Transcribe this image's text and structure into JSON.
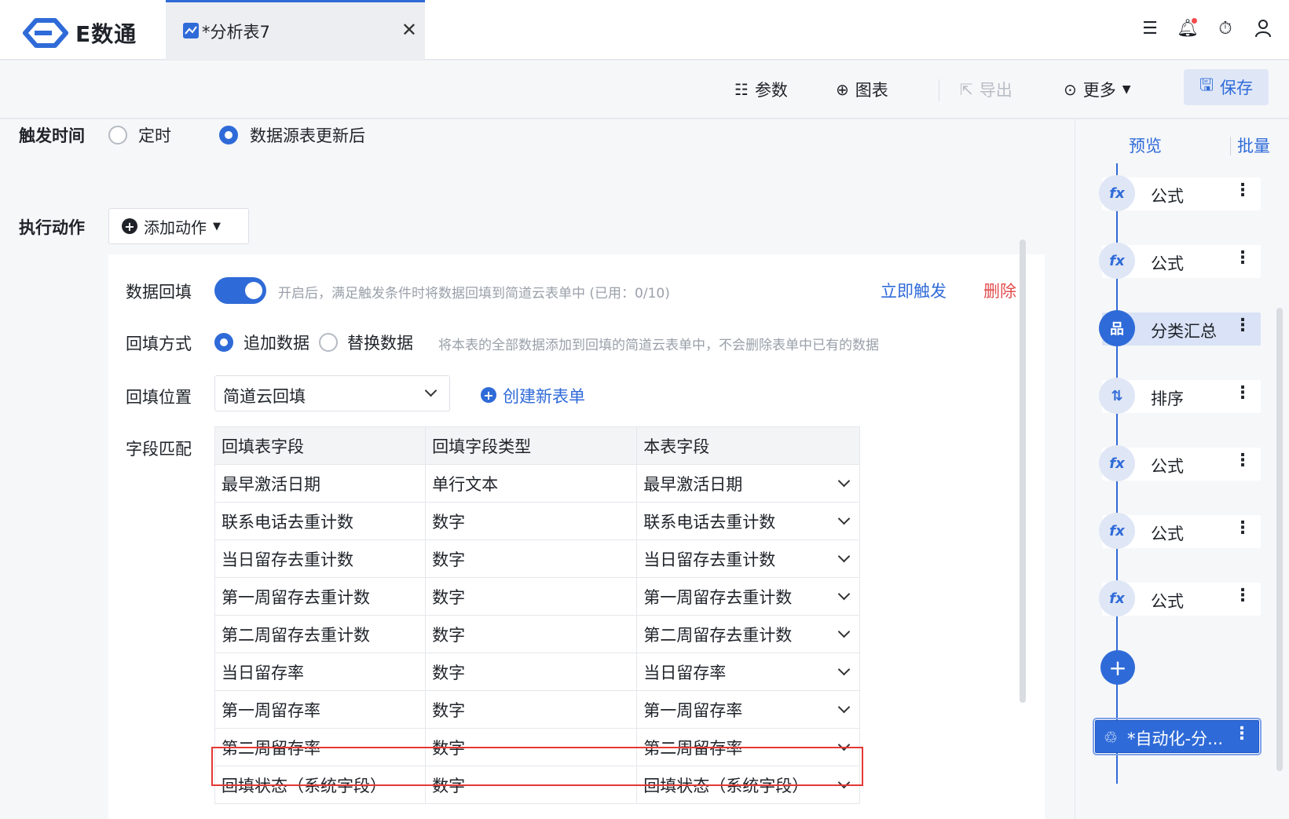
{
  "app": {
    "logo_text": "E数通"
  },
  "tab": {
    "label": "*分析表7",
    "close": "✕"
  },
  "toolbar": {
    "params": "参数",
    "chart": "图表",
    "export": "导出",
    "more": "更多",
    "save": "保存"
  },
  "trigger": {
    "label": "触发时间",
    "option_timed": "定时",
    "option_after_update": "数据源表更新后",
    "selected": "数据源表更新后"
  },
  "action": {
    "label": "执行动作",
    "add_button": "添加动作"
  },
  "backfill": {
    "label": "数据回填",
    "enabled": true,
    "hint": "开启后，满足触发条件时将数据回填到简道云表单中 (已用：0/10)",
    "trigger_now": "立即触发",
    "delete": "删除",
    "mode_label": "回填方式",
    "mode_append": "追加数据",
    "mode_replace": "替换数据",
    "mode_selected": "追加数据",
    "mode_hint": "将本表的全部数据添加到回填的简道云表单中，不会删除表单中已有的数据",
    "position_label": "回填位置",
    "position_value": "简道云回填",
    "create_form": "创建新表单",
    "mapping_label": "字段匹配"
  },
  "mapping": {
    "headers": [
      "回填表字段",
      "回填字段类型",
      "本表字段"
    ],
    "rows": [
      [
        "最早激活日期",
        "单行文本",
        "最早激活日期"
      ],
      [
        "联系电话去重计数",
        "数字",
        "联系电话去重计数"
      ],
      [
        "当日留存去重计数",
        "数字",
        "当日留存去重计数"
      ],
      [
        "第一周留存去重计数",
        "数字",
        "第一周留存去重计数"
      ],
      [
        "第二周留存去重计数",
        "数字",
        "第二周留存去重计数"
      ],
      [
        "当日留存率",
        "数字",
        "当日留存率"
      ],
      [
        "第一周留存率",
        "数字",
        "第一周留存率"
      ],
      [
        "第二周留存率",
        "数字",
        "第二周留存率"
      ],
      [
        "回填状态（系统字段）",
        "数字",
        "回填状态（系统字段）"
      ]
    ]
  },
  "right_panel": {
    "preview": "预览",
    "batch": "批量",
    "nodes": [
      {
        "label": "公式",
        "icon": "fx-icon",
        "glyph": "fx"
      },
      {
        "label": "公式",
        "icon": "fx-icon",
        "glyph": "fx"
      },
      {
        "label": "分类汇总",
        "icon": "hierarchy-icon",
        "glyph": "品",
        "active": true
      },
      {
        "label": "排序",
        "icon": "sort-icon",
        "glyph": "⇅"
      },
      {
        "label": "公式",
        "icon": "fx-icon",
        "glyph": "fx"
      },
      {
        "label": "公式",
        "icon": "fx-icon",
        "glyph": "fx"
      },
      {
        "label": "公式",
        "icon": "fx-icon",
        "glyph": "fx"
      }
    ],
    "add": "+",
    "automation": "*自动化-分..."
  },
  "colors": {
    "accent": "#2f6bd8",
    "danger": "#e34d4d",
    "highlight": "#e53935"
  }
}
